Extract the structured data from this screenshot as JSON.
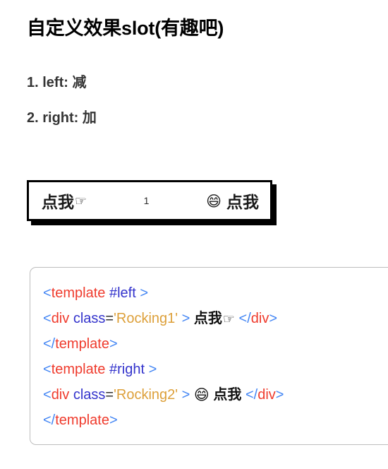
{
  "page": {
    "background": "#ffffff",
    "heading": "自定义效果slot(有趣吧)"
  },
  "list": {
    "items": [
      {
        "marker": "1.",
        "text": "left: 减"
      },
      {
        "marker": "2.",
        "text": "right: 加"
      }
    ]
  },
  "widget": {
    "left_label": "点我",
    "left_icon": "☞",
    "left_icon_name": "pointing-hand-icon",
    "count": "1",
    "right_icon": "😄",
    "right_icon_name": "grinning-face-icon",
    "right_label": "点我",
    "border_color": "#000000",
    "shadow_color": "#000000",
    "background": "#ffffff"
  },
  "code": {
    "border_color": "#bdbdbd",
    "colors": {
      "punct": "#4285f4",
      "tag": "#ef3b2d",
      "attr": "#3333cc",
      "equals": "#303030",
      "value": "#dda03a",
      "text": "#111111"
    },
    "lines": [
      {
        "id": "line-1",
        "tokens": [
          {
            "t": "punct",
            "v": "<"
          },
          {
            "t": "tag",
            "v": "template"
          },
          {
            "t": "plain",
            "v": " "
          },
          {
            "t": "attr",
            "v": "#left"
          },
          {
            "t": "plain",
            "v": " "
          },
          {
            "t": "punct",
            "v": ">"
          }
        ]
      },
      {
        "id": "line-2",
        "tokens": [
          {
            "t": "punct",
            "v": "<"
          },
          {
            "t": "tag",
            "v": "div"
          },
          {
            "t": "plain",
            "v": " "
          },
          {
            "t": "attr",
            "v": "class"
          },
          {
            "t": "eq",
            "v": "="
          },
          {
            "t": "value",
            "v": "'Rocking1'"
          },
          {
            "t": "plain",
            "v": " "
          },
          {
            "t": "punct",
            "v": ">"
          },
          {
            "t": "plain",
            "v": " "
          },
          {
            "t": "text",
            "v": "点我"
          },
          {
            "t": "hand",
            "v": "☞"
          },
          {
            "t": "plain",
            "v": " "
          },
          {
            "t": "punct",
            "v": "</"
          },
          {
            "t": "tag",
            "v": "div"
          },
          {
            "t": "punct",
            "v": ">"
          }
        ]
      },
      {
        "id": "line-3",
        "tokens": [
          {
            "t": "punct",
            "v": "</"
          },
          {
            "t": "tag",
            "v": "template"
          },
          {
            "t": "punct",
            "v": ">"
          }
        ]
      },
      {
        "id": "line-4",
        "tokens": [
          {
            "t": "punct",
            "v": "<"
          },
          {
            "t": "tag",
            "v": "template"
          },
          {
            "t": "plain",
            "v": " "
          },
          {
            "t": "attr",
            "v": "#right"
          },
          {
            "t": "plain",
            "v": " "
          },
          {
            "t": "punct",
            "v": ">"
          }
        ]
      },
      {
        "id": "line-5",
        "tokens": [
          {
            "t": "punct",
            "v": "<"
          },
          {
            "t": "tag",
            "v": "div"
          },
          {
            "t": "plain",
            "v": " "
          },
          {
            "t": "attr",
            "v": "class"
          },
          {
            "t": "eq",
            "v": "="
          },
          {
            "t": "value",
            "v": "'Rocking2'"
          },
          {
            "t": "plain",
            "v": " "
          },
          {
            "t": "punct",
            "v": ">"
          },
          {
            "t": "plain",
            "v": " "
          },
          {
            "t": "grin",
            "v": "😄"
          },
          {
            "t": "plain",
            "v": " "
          },
          {
            "t": "text",
            "v": "点我"
          },
          {
            "t": "plain",
            "v": " "
          },
          {
            "t": "punct",
            "v": "</"
          },
          {
            "t": "tag",
            "v": "div"
          },
          {
            "t": "punct",
            "v": ">"
          }
        ]
      },
      {
        "id": "line-6",
        "tokens": [
          {
            "t": "punct",
            "v": "</"
          },
          {
            "t": "tag",
            "v": "template"
          },
          {
            "t": "punct",
            "v": ">"
          }
        ]
      }
    ]
  }
}
